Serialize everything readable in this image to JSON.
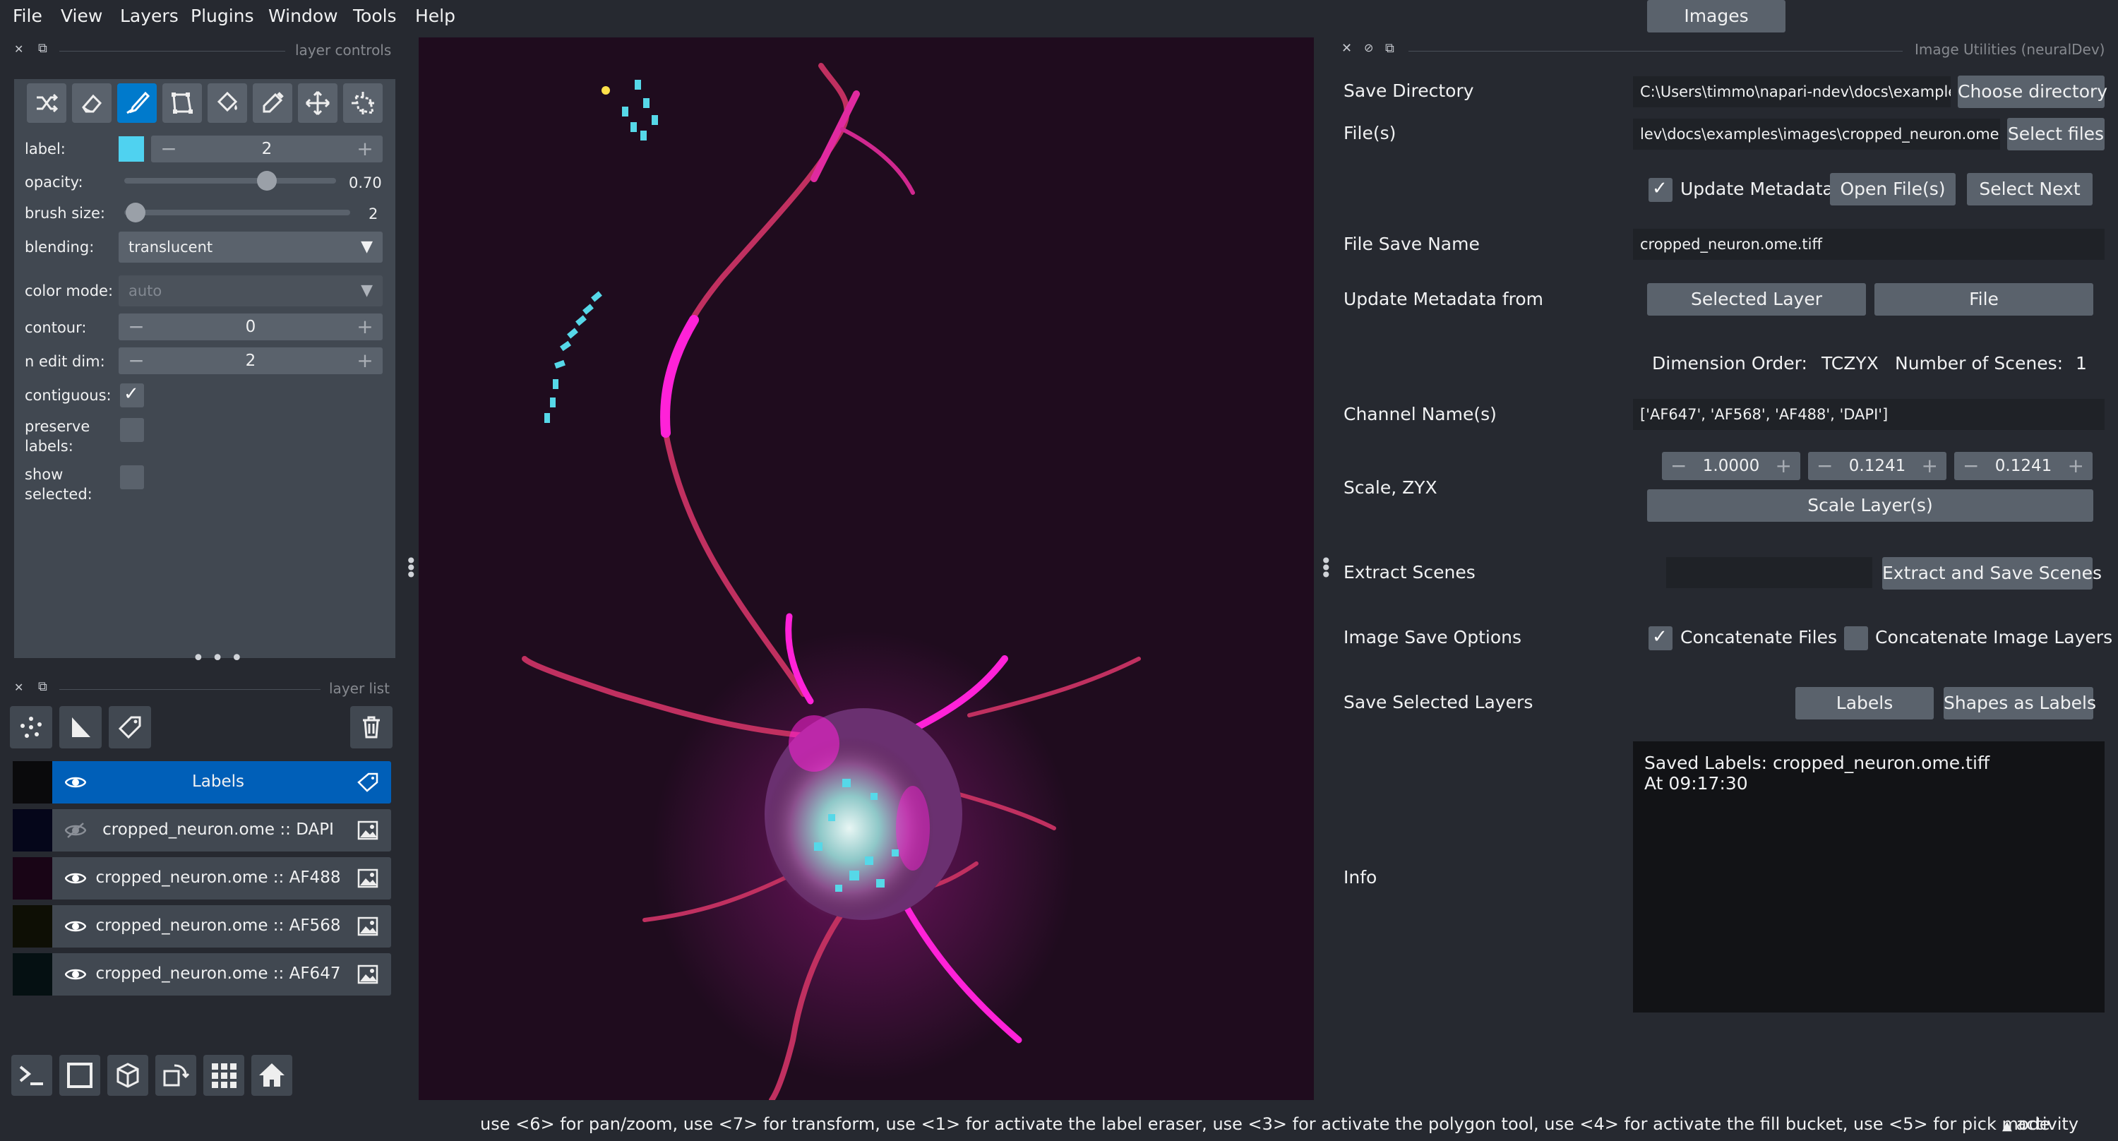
{
  "menubar": {
    "items": [
      "File",
      "View",
      "Layers",
      "Plugins",
      "Window",
      "Tools",
      "Help"
    ]
  },
  "layer_controls": {
    "header": "layer controls",
    "tools": [
      "shuffle-icon",
      "eraser-icon",
      "paintbrush-icon",
      "polygon-icon",
      "fill-bucket-icon",
      "picker-icon",
      "pan-zoom-icon",
      "transform-icon"
    ],
    "label": {
      "name": "label:",
      "value": "2",
      "color": "#4fd2f0"
    },
    "opacity": {
      "name": "opacity:",
      "value": "0.70",
      "fraction": 0.7
    },
    "brush_size": {
      "name": "brush size:",
      "value": "2",
      "fraction": 0.05
    },
    "blending": {
      "name": "blending:",
      "value": "translucent"
    },
    "color_mode": {
      "name": "color mode:",
      "value": "auto"
    },
    "contour": {
      "name": "contour:",
      "value": "0"
    },
    "n_edit_dim": {
      "name": "n edit dim:",
      "value": "2"
    },
    "contiguous": {
      "name": "contiguous:",
      "checked": true
    },
    "preserve_labels": {
      "name_1": "preserve",
      "name_2": "labels:",
      "checked": false
    },
    "show_selected": {
      "name_1": "show",
      "name_2": "selected:",
      "checked": false
    }
  },
  "layer_list": {
    "header": "layer list",
    "buttons": [
      "new-points-icon",
      "new-shapes-icon",
      "new-labels-icon",
      "delete-icon"
    ],
    "layers": [
      {
        "name": "Labels",
        "visible": true,
        "selected": true,
        "type": "labels-icon"
      },
      {
        "name": "cropped_neuron.ome :: DAPI",
        "visible": false,
        "selected": false,
        "type": "image-icon"
      },
      {
        "name": "cropped_neuron.ome :: AF488",
        "visible": true,
        "selected": false,
        "type": "image-icon"
      },
      {
        "name": "cropped_neuron.ome :: AF568",
        "visible": true,
        "selected": false,
        "type": "image-icon"
      },
      {
        "name": "cropped_neuron.ome :: AF647",
        "visible": true,
        "selected": false,
        "type": "image-icon"
      }
    ]
  },
  "bottom_buttons": [
    "console-icon",
    "ndisplay-2d-icon",
    "ndisplay-3d-icon",
    "roll-dims-icon",
    "grid-icon",
    "home-icon"
  ],
  "image_utilities": {
    "header": "Image Utilities (neuralDev)",
    "save_directory": {
      "label": "Save Directory",
      "value": "C:\\Users\\timmo\\napari-ndev\\docs\\examples",
      "button": "Choose directory"
    },
    "files": {
      "label": "File(s)",
      "value": "lev\\docs\\examples\\images\\cropped_neuron.ome.tiff",
      "button": "Select files"
    },
    "update_metadata": {
      "label": "Update Metadata",
      "checked": true
    },
    "open_files": "Open File(s)",
    "select_next": "Select Next",
    "file_save_name": {
      "label": "File Save Name",
      "value": "cropped_neuron.ome.tiff"
    },
    "update_metadata_from": {
      "label": "Update Metadata from",
      "selected_layer": "Selected Layer",
      "file": "File"
    },
    "dimension_order": {
      "label": "Dimension Order:",
      "value": "TCZYX"
    },
    "number_of_scenes": {
      "label": "Number of Scenes:",
      "value": "1"
    },
    "channel_names": {
      "label": "Channel Name(s)",
      "value": "['AF647', 'AF568', 'AF488', 'DAPI']"
    },
    "scale": {
      "label": "Scale, ZYX",
      "z": "1.0000",
      "y": "0.1241",
      "x": "0.1241",
      "button": "Scale Layer(s)"
    },
    "extract_scenes": {
      "label": "Extract Scenes",
      "value": "",
      "button": "Extract and Save Scenes"
    },
    "image_save_options": {
      "label": "Image Save Options",
      "concat_files": "Concatenate Files",
      "concat_files_checked": true,
      "concat_layers": "Concatenate Image Layers",
      "concat_layers_checked": false
    },
    "save_selected_layers": {
      "label": "Save Selected Layers",
      "images": "Images",
      "labels": "Labels",
      "shapes_as_labels": "Shapes as Labels"
    },
    "info": {
      "label": "Info",
      "line1": "Saved Labels: cropped_neuron.ome.tiff",
      "line2": "At 09:17:30"
    }
  },
  "status_bar": {
    "text": "use <6> for pan/zoom, use <7> for transform, use <1> for activate the label eraser, use <3> for activate the polygon tool, use <4> for activate the fill bucket, use <5> for pick mode",
    "activity": "activity"
  },
  "colors": {
    "accent": "#007acc",
    "selected_layer": "#005fb8",
    "canvas_bg": "#1f0c1e",
    "neuron_magenta": "#ff1fd8",
    "labels_cyan": "#4fd2f0"
  }
}
